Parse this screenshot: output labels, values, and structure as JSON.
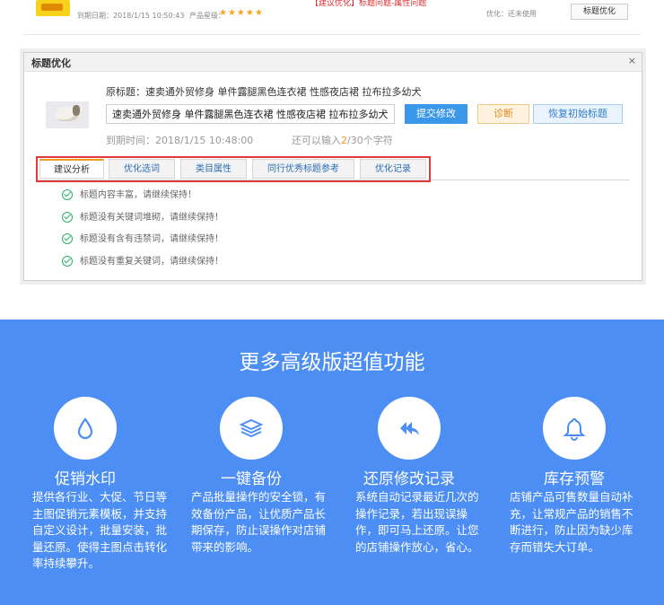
{
  "top_strip": {
    "expire_label": "到期日期：2018/1/15 10:50:43",
    "rating_label": "产品星级：",
    "stars": "★★★★★",
    "suggestion_text": "【建议优化】标题问题-属性问题",
    "optimize_status": "优化：还未使用",
    "optimize_button": "标题优化"
  },
  "dialog": {
    "title": "标题优化",
    "close": "×",
    "original_title": "原标题：速卖通外贸修身 单件露腿黑色连衣裙 性感夜店裙 拉布拉多幼犬",
    "input_value": "速卖通外贸修身 单件露腿黑色连衣裙 性感夜店裙 拉布拉多幼犬",
    "submit_button": "提交修改",
    "diagnose_button": "诊断",
    "restore_button": "恢复初始标题",
    "expire_time": "到期时间：2018/1/15 10:48:00",
    "remaining_prefix": "还可以输入",
    "remaining_count": "2",
    "remaining_suffix": "/30个字符",
    "tabs": [
      "建议分析",
      "优化选词",
      "类目属性",
      "同行优秀标题参考",
      "优化记录"
    ],
    "checks": [
      "标题内容丰富，请继续保持！",
      "标题没有关键词堆砌，请继续保持！",
      "标题没有含有违禁词，请继续保持！",
      "标题没有重复关键词，请继续保持！"
    ]
  },
  "features": {
    "heading": "更多高级版超值功能",
    "items": [
      {
        "icon": "water-drop-icon",
        "name": "促销水印",
        "desc": "提供各行业、大促、节日等主图促销元素模板，并支持自定义设计，批量安装，批量还原。使得主图点击转化率持续攀升。"
      },
      {
        "icon": "layers-icon",
        "name": "一键备份",
        "desc": "产品批量操作的安全锁，有效备份产品，让优质产品长期保存，防止误操作对店铺带来的影响。"
      },
      {
        "icon": "undo-arrows-icon",
        "name": "还原修改记录",
        "desc": "系统自动记录最近几次的操作记录，若出现误操作，即可马上还原。让您的店铺操作放心，省心。"
      },
      {
        "icon": "bell-icon",
        "name": "库存预警",
        "desc": "店铺产品可售数量自动补充，让常规产品的销售不断进行，防止因为缺少库存而错失大订单。"
      }
    ]
  },
  "colors": {
    "accent_blue": "#4c8ef4",
    "submit_blue": "#3a97ea",
    "highlight_red": "#e03a3a",
    "check_green": "#2ab46b",
    "orange": "#f39a1e"
  }
}
